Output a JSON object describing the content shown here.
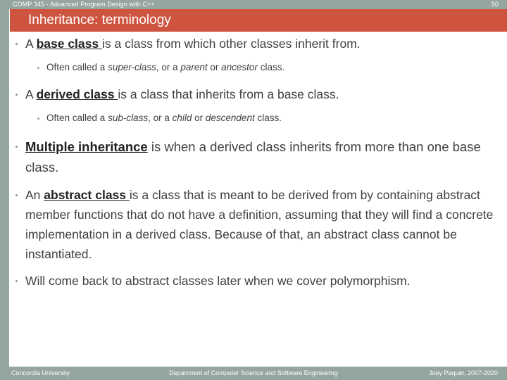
{
  "header": {
    "course_title": "COMP 345 - Advanced Program Design with C++",
    "page_number": "50",
    "band_color": "#94a69e"
  },
  "slide": {
    "title": "Inheritance: terminology",
    "title_bar_color": "#ce5440",
    "title_text_color": "#ffffff"
  },
  "body": {
    "bullets": [
      {
        "id": "base-class",
        "lead": "A ",
        "term": "base class ",
        "rest": "is a class from which other classes inherit from.",
        "sub": {
          "pre": "Often called a ",
          "i1": "super-class",
          "mid1": ", or a ",
          "i2": "parent",
          "mid2": " or ",
          "i3": "ancestor",
          "post": " class."
        }
      },
      {
        "id": "derived-class",
        "lead": "A ",
        "term": "derived class ",
        "rest": "is a class that inherits from a base class.",
        "sub": {
          "pre": "Often called a ",
          "i1": "sub-class",
          "mid1": ", or a ",
          "i2": "child",
          "mid2": " or ",
          "i3": "descendent",
          "post": " class."
        }
      },
      {
        "id": "multiple-inheritance",
        "lead": "",
        "term": "Multiple inheritance",
        "rest": " is when a derived class inherits from more than one base class."
      },
      {
        "id": "abstract-class",
        "lead": "An ",
        "term": "abstract class ",
        "rest": "is a class that is meant to be derived from by containing abstract member functions that do not have a definition, assuming that they will find a concrete implementation in a derived class. Because of that, an abstract class cannot be instantiated."
      },
      {
        "id": "polymorphism-note",
        "lead": "",
        "term": "",
        "rest": "Will come back to abstract classes later when we cover polymorphism."
      }
    ]
  },
  "footer": {
    "left": "Concordia University",
    "center": "Department of Computer Science and Software Engineering",
    "right": "Joey Paquet, 2007-2020"
  }
}
